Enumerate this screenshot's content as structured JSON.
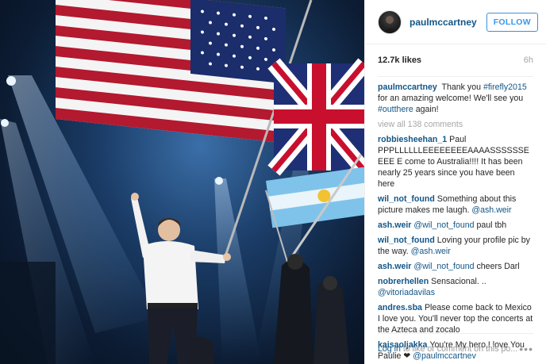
{
  "post": {
    "username": "paulmccartney",
    "follow_label": "FOLLOW",
    "likes": "12.7k likes",
    "time": "6h",
    "caption": {
      "user": "paulmccartney",
      "t1": " Thank you ",
      "tag1": "#firefly2015",
      "t2": " for an amazing welcome! We'll see you ",
      "tag2": "#outthere",
      "t3": " again!"
    },
    "view_all": "view all 138 comments",
    "comments": [
      {
        "user": "robbiesheehan_1",
        "text": "Paul PPPLLLLLLEEEEEEEEAAAASSSSSSEEEE E come to Australia!!!! It has been nearly 25 years since you have been here",
        "mention": ""
      },
      {
        "user": "wil_not_found",
        "text": "Something about this picture makes me laugh. ",
        "mention": "@ash.weir"
      },
      {
        "user": "ash.weir",
        "text": " paul tbh",
        "mention": "@wil_not_found",
        "mention_first": true
      },
      {
        "user": "wil_not_found",
        "text": "Loving your profile pic by the way. ",
        "mention": "@ash.weir"
      },
      {
        "user": "ash.weir",
        "text": " cheers Darl",
        "mention": "@wil_not_found",
        "mention_first": true
      },
      {
        "user": "nobrerhellen",
        "text": "Sensacional. .. ",
        "mention": "@vitoriadavilas"
      },
      {
        "user": "andres.sba",
        "text": "Please come back to Mexico I love you. You'll never top the concerts at the Azteca and zocalo",
        "mention": ""
      },
      {
        "user": "kaisaoljakka",
        "text": "You're My hero,I love You Paulie ❤ ",
        "mention": "@paulmccartnev"
      }
    ],
    "footer": {
      "login": "Log in",
      "rest": " to like or comment on this po...",
      "more": "•••"
    }
  },
  "icons": {
    "avatar": "profile-photo",
    "more": "more-options-icon"
  },
  "colors": {
    "username": "#125688",
    "follow": "#3897f0",
    "muted": "#a5a7aa"
  }
}
